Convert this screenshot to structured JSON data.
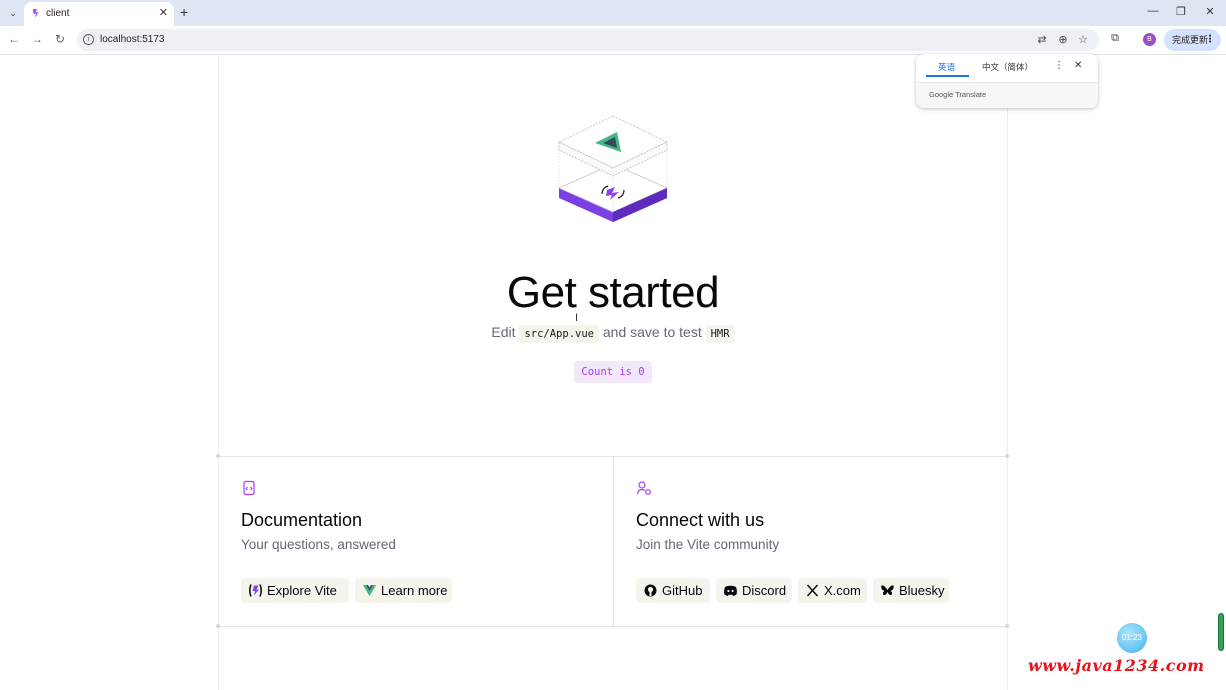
{
  "browser": {
    "tab_title": "client",
    "url": "localhost:5173",
    "update_button": "完成更新",
    "avatar_letter": "B",
    "new_tab_glyph": "+",
    "close_glyph": "✕"
  },
  "translate_popup": {
    "source_lang": "英语",
    "target_lang": "中文（简体）",
    "brand": "Google Translate",
    "accent_color": "#1a73e8"
  },
  "hero": {
    "title": "Get started",
    "subtitle_edit": "Edit",
    "subtitle_file": "src/App.vue",
    "subtitle_mid": "and save to test",
    "subtitle_hmr": "HMR"
  },
  "counter": {
    "label": "Count is 0",
    "color": "#aa3bff"
  },
  "documentation": {
    "icon": "docs-icon",
    "title": "Documentation",
    "subtitle": "Your questions, answered",
    "links": [
      {
        "label": "Explore Vite",
        "icon": "vite-logo-icon"
      },
      {
        "label": "Learn more",
        "icon": "vue-logo-icon"
      }
    ]
  },
  "community": {
    "icon": "community-icon",
    "title": "Connect with us",
    "subtitle": "Join the Vite community",
    "links": [
      {
        "label": "GitHub",
        "icon": "github-icon"
      },
      {
        "label": "Discord",
        "icon": "discord-icon"
      },
      {
        "label": "X.com",
        "icon": "x-icon"
      },
      {
        "label": "Bluesky",
        "icon": "bluesky-icon"
      }
    ]
  },
  "overlay": {
    "timer": "01:23",
    "watermark": "www.java1234.com"
  }
}
